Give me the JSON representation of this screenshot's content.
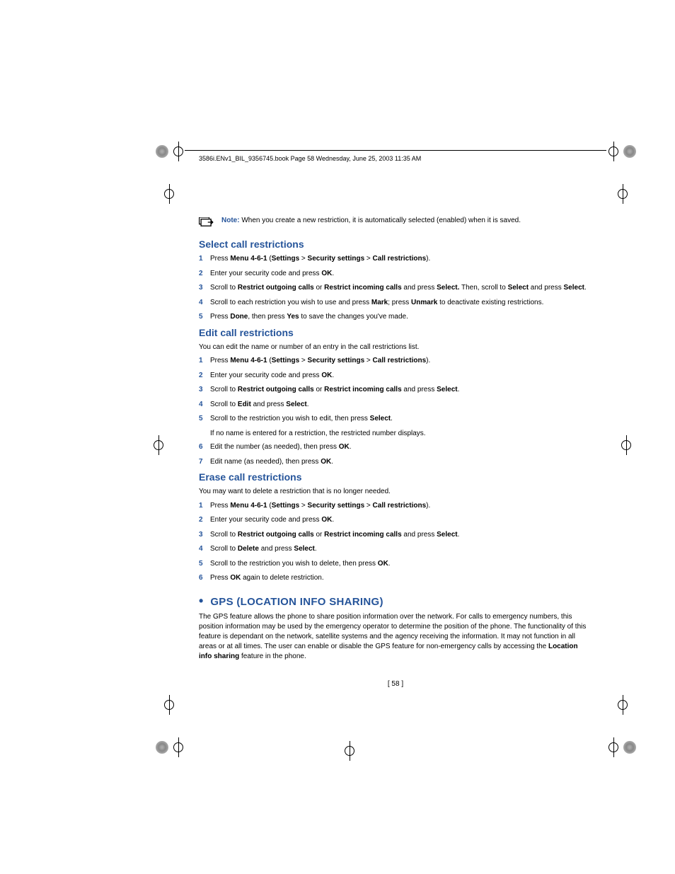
{
  "header": "3586i.ENv1_BIL_9356745.book  Page 58  Wednesday, June 25, 2003  11:35 AM",
  "note": {
    "label": "Note:",
    "text": " When you create a new restriction, it is automatically selected (enabled) when it is saved."
  },
  "sections": {
    "select": {
      "title": "Select call restrictions",
      "steps": [
        {
          "n": "1",
          "pre": "Press ",
          "b1": "Menu 4-6-1",
          "mid1": " (",
          "b2": "Settings",
          "mid2": " > ",
          "b3": "Security settings",
          "mid3": " > ",
          "b4": "Call restrictions",
          "post": ")."
        },
        {
          "n": "2",
          "pre": "Enter your security code and press ",
          "b1": "OK",
          "post": "."
        },
        {
          "n": "3",
          "pre": "Scroll to ",
          "b1": "Restrict outgoing calls",
          "mid1": " or ",
          "b2": "Restrict incoming calls",
          "mid2": " and press ",
          "b3": "Select.",
          "mid3": " Then, scroll to ",
          "b4": "Select",
          "mid4": " and press ",
          "b5": "Select",
          "post": "."
        },
        {
          "n": "4",
          "pre": "Scroll to each restriction you wish to use and press ",
          "b1": "Mark",
          "mid1": "; press ",
          "b2": "Unmark",
          "post": " to deactivate existing restrictions."
        },
        {
          "n": "5",
          "pre": "Press ",
          "b1": "Done",
          "mid1": ", then press ",
          "b2": "Yes",
          "post": " to save the changes you've made."
        }
      ]
    },
    "edit": {
      "title": "Edit call restrictions",
      "intro": "You can edit the name or number of an entry in the call restrictions list.",
      "steps": [
        {
          "n": "1",
          "pre": "Press ",
          "b1": "Menu 4-6-1",
          "mid1": " (",
          "b2": "Settings",
          "mid2": " > ",
          "b3": "Security settings",
          "mid3": " > ",
          "b4": "Call restrictions",
          "post": ")."
        },
        {
          "n": "2",
          "pre": "Enter your security code and press ",
          "b1": "OK",
          "post": "."
        },
        {
          "n": "3",
          "pre": "Scroll to ",
          "b1": "Restrict outgoing calls",
          "mid1": " or ",
          "b2": "Restrict incoming calls",
          "mid2": " and press ",
          "b3": "Select",
          "post": "."
        },
        {
          "n": "4",
          "pre": "Scroll to ",
          "b1": "Edit",
          "mid1": " and press ",
          "b2": "Select",
          "post": "."
        },
        {
          "n": "5",
          "pre": "Scroll to the restriction you wish to edit, then press ",
          "b1": "Select",
          "post": ".",
          "sub": "If no name is entered for a restriction, the restricted number displays."
        },
        {
          "n": "6",
          "pre": "Edit the number (as needed), then press ",
          "b1": "OK",
          "post": "."
        },
        {
          "n": "7",
          "pre": "Edit name (as needed), then press ",
          "b1": "OK",
          "post": "."
        }
      ]
    },
    "erase": {
      "title": "Erase call restrictions",
      "intro": "You may want to delete a restriction that is no longer needed.",
      "steps": [
        {
          "n": "1",
          "pre": "Press ",
          "b1": "Menu 4-6-1",
          "mid1": " (",
          "b2": "Settings",
          "mid2": " > ",
          "b3": "Security settings",
          "mid3": " > ",
          "b4": "Call restrictions",
          "post": ")."
        },
        {
          "n": "2",
          "pre": "Enter your security code and press ",
          "b1": "OK",
          "post": "."
        },
        {
          "n": "3",
          "pre": "Scroll to ",
          "b1": "Restrict outgoing calls",
          "mid1": " or ",
          "b2": "Restrict incoming calls",
          "mid2": " and press ",
          "b3": "Select",
          "post": "."
        },
        {
          "n": "4",
          "pre": "Scroll to ",
          "b1": "Delete",
          "mid1": " and press ",
          "b2": "Select",
          "post": "."
        },
        {
          "n": "5",
          "pre": "Scroll to the restriction you wish to delete, then press ",
          "b1": "OK",
          "post": "."
        },
        {
          "n": "6",
          "pre": "Press ",
          "b1": "OK",
          "post": " again to delete restriction."
        }
      ]
    },
    "gps": {
      "bullet": "•",
      "title": "GPS (LOCATION INFO SHARING)",
      "body_pre": "The GPS feature allows the phone to share position information over the network. For calls to emergency numbers, this position information may be used by the emergency operator to determine the position of the phone. The functionality of this feature is dependant on the network, satellite systems and the agency receiving the information. It may not function in all areas or at all times. The user can enable or disable the GPS feature for non-emergency calls by accessing the ",
      "b1": "Location info sharing",
      "body_post": " feature in the phone."
    }
  },
  "pageNum": "[ 58 ]"
}
